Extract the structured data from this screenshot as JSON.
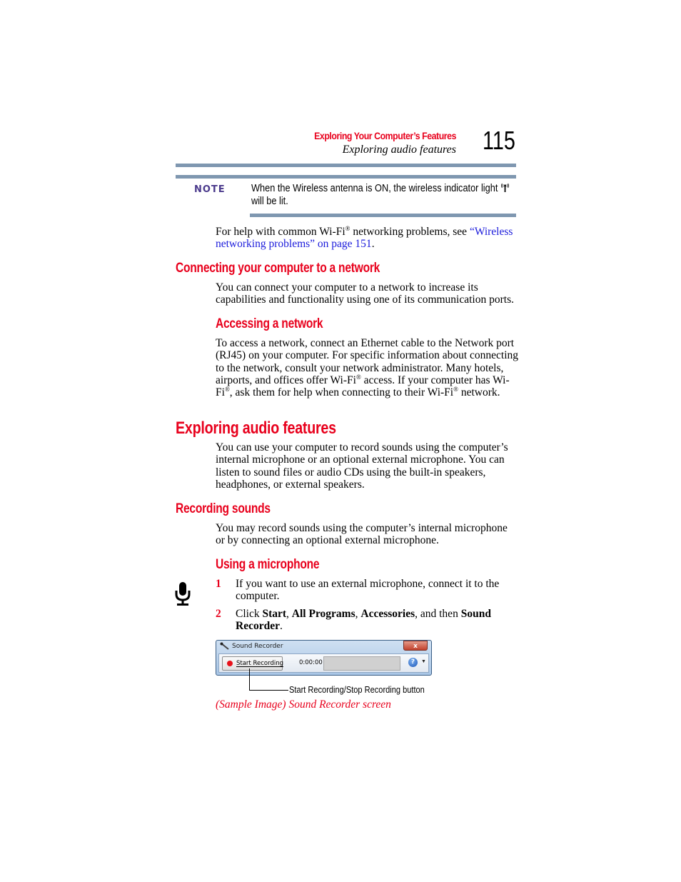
{
  "header": {
    "chapter": "Exploring Your Computer’s Features",
    "section": "Exploring audio features",
    "page_number": "115"
  },
  "note": {
    "label": "NOTE",
    "text_before_icon": "When the Wireless antenna is ON, the wireless indicator light",
    "icon": "wireless-antenna-icon",
    "text_after_icon": "will be lit."
  },
  "wifi_help": {
    "text_1": "For help with common Wi-Fi",
    "reg": "®",
    "text_2": " networking problems, see ",
    "link": "“Wireless networking problems” on page 151",
    "text_3": "."
  },
  "sections": {
    "connecting": {
      "heading": "Connecting your computer to a network",
      "body": "You can connect your computer to a network to increase its capabilities and functionality using one of its communication ports."
    },
    "accessing": {
      "heading": "Accessing a network",
      "body_1": "To access a network, connect an Ethernet cable to the Network port (RJ45) on your computer. For specific information about connecting to the network, consult your network administrator. Many hotels, airports, and offices offer Wi-Fi",
      "body_2": " access. If your computer has Wi-Fi",
      "body_3": ", ask them for help when connecting to their Wi-Fi",
      "body_4": " network.",
      "reg": "®"
    },
    "audio": {
      "heading": "Exploring audio features",
      "body": "You can use your computer to record sounds using the computer’s internal microphone or an optional external microphone. You can listen to sound files or audio CDs using the built-in speakers, headphones, or external speakers."
    },
    "recording": {
      "heading": "Recording sounds",
      "body": "You may record sounds using the computer’s internal microphone or by connecting an optional external microphone."
    },
    "microphone": {
      "heading": "Using a microphone",
      "icon": "microphone-icon",
      "steps": [
        {
          "num": "1",
          "text": "If you want to use an external microphone, connect it to the computer."
        },
        {
          "num": "2",
          "parts": [
            "Click ",
            "Start",
            ", ",
            "All Programs",
            ", ",
            "Accessories",
            ", and then ",
            "Sound Recorder",
            "."
          ]
        }
      ]
    }
  },
  "sound_recorder": {
    "title": "Sound Recorder",
    "close_label": "x",
    "start_button": "Start Recording",
    "time": "0:00:00",
    "help_label": "?",
    "dropdown": "▼",
    "callout": "Start Recording/Stop Recording button",
    "caption": "(Sample Image) Sound Recorder screen"
  },
  "colors": {
    "heading_red": "#e8001c",
    "link_blue": "#1a1adb",
    "rule_blue": "#7f97b0",
    "note_purple": "#4b3a8c"
  }
}
